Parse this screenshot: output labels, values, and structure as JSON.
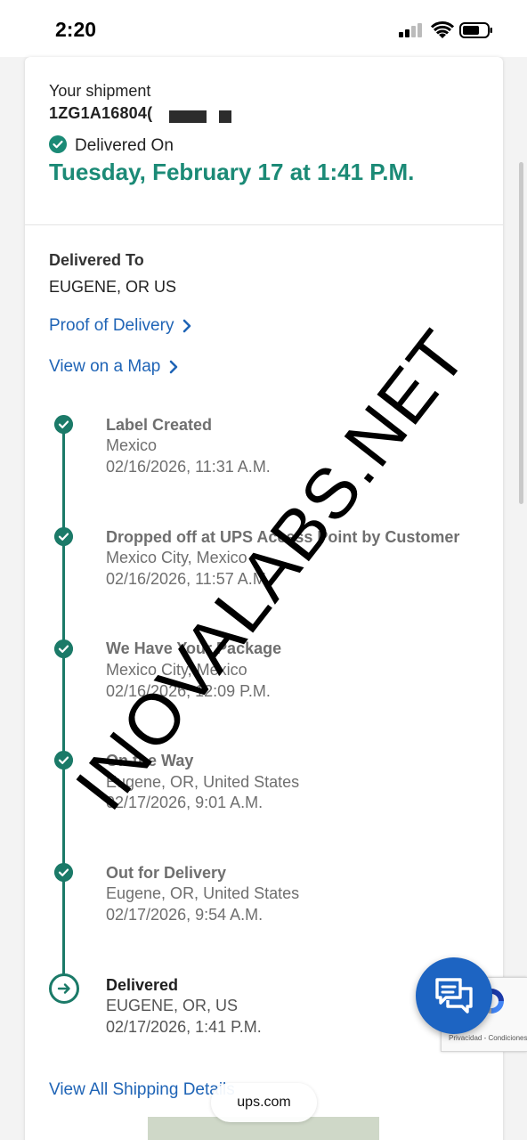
{
  "status_bar": {
    "time": "2:20"
  },
  "shipment": {
    "label": "Your shipment",
    "tracking_number": "1ZG1A16804(",
    "status_label": "Delivered On",
    "delivery_datetime": "Tuesday, February 17 at 1:41 P.M."
  },
  "delivered_to": {
    "label": "Delivered To",
    "value": "EUGENE, OR US"
  },
  "links": {
    "proof_of_delivery": "Proof of Delivery",
    "view_on_map": "View on a Map",
    "view_all_details": "View All Shipping Details"
  },
  "timeline": [
    {
      "title": "Label Created",
      "location": "Mexico",
      "datetime": "02/16/2026, 11:31 A.M."
    },
    {
      "title": "Dropped off at UPS Access Point by Customer",
      "location": "Mexico City, Mexico",
      "datetime": "02/16/2026, 11:57 A.M."
    },
    {
      "title": "We Have Your Package",
      "location": "Mexico City, Mexico",
      "datetime": "02/16/2026, 12:09 P.M."
    },
    {
      "title": "On the Way",
      "location": "Eugene, OR, United States",
      "datetime": "02/17/2026, 9:01 A.M."
    },
    {
      "title": "Out for Delivery",
      "location": "Eugene, OR, United States",
      "datetime": "02/17/2026, 9:54 A.M."
    },
    {
      "title": "Delivered",
      "location": "EUGENE, OR, US",
      "datetime": "02/17/2026, 1:41 P.M."
    }
  ],
  "recaptcha": {
    "text": "Privacidad - Condiciones"
  },
  "browser": {
    "url": "ups.com"
  },
  "watermark": "INOVALABS.NET",
  "colors": {
    "accent_green": "#1b8a76",
    "timeline_green": "#1b7a68",
    "link_blue": "#1f64b6",
    "fab_blue": "#1d64c2"
  },
  "icons": {
    "check": "check-circle-icon",
    "chevron": "chevron-right-icon",
    "arrow": "arrow-circle-icon",
    "chat": "chat-icon"
  }
}
